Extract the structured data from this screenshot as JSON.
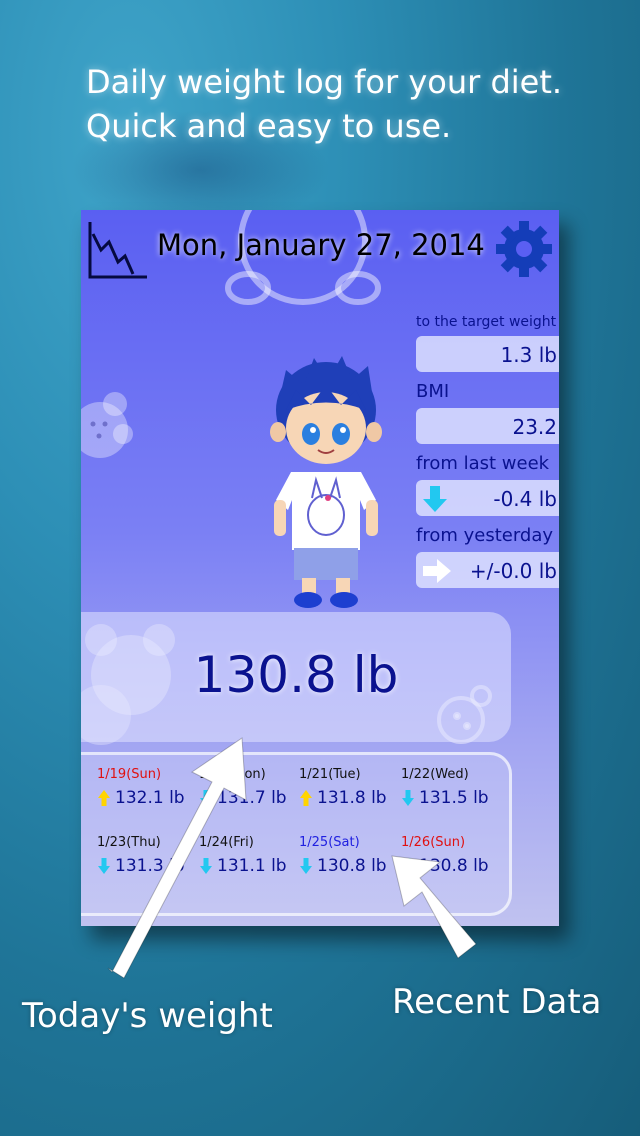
{
  "promo": {
    "line1": "Daily weight log for your diet.",
    "line2": "Quick and easy to use.",
    "callout_today": "Today's weight",
    "callout_recent": "Recent Data"
  },
  "header": {
    "date": "Mon, January 27, 2014",
    "chart_icon": "weight-chart-icon",
    "settings_icon": "gear-icon"
  },
  "stats": {
    "target_label": "to the target weight",
    "target_value": "1.3 lb",
    "bmi_label": "BMI",
    "bmi_value": "23.2",
    "week_label": "from last week",
    "week_value": "-0.4 lb",
    "week_arrow": "down",
    "yesterday_label": "from yesterday",
    "yesterday_value": "+/-0.0 lb",
    "yesterday_arrow": "right"
  },
  "today": {
    "weight": "130.8 lb"
  },
  "recent": [
    {
      "date": "1/19(Sun)",
      "value": "132.1 lb",
      "trend": "up",
      "day_color": "red"
    },
    {
      "date": "1/20(Mon)",
      "value": "131.7 lb",
      "trend": "down",
      "day_color": "black"
    },
    {
      "date": "1/21(Tue)",
      "value": "131.8 lb",
      "trend": "up",
      "day_color": "black"
    },
    {
      "date": "1/22(Wed)",
      "value": "131.5 lb",
      "trend": "down",
      "day_color": "black"
    },
    {
      "date": "1/23(Thu)",
      "value": "131.3 lb",
      "trend": "down",
      "day_color": "black"
    },
    {
      "date": "1/24(Fri)",
      "value": "131.1 lb",
      "trend": "down",
      "day_color": "black"
    },
    {
      "date": "1/25(Sat)",
      "value": "130.8 lb",
      "trend": "down",
      "day_color": "blue"
    },
    {
      "date": "1/26(Sun)",
      "value": "130.8 lb",
      "trend": "down",
      "day_color": "red"
    }
  ],
  "colors": {
    "up_arrow": "#ffd400",
    "down_arrow": "#22c8f0",
    "text_navy": "#0a128f"
  }
}
